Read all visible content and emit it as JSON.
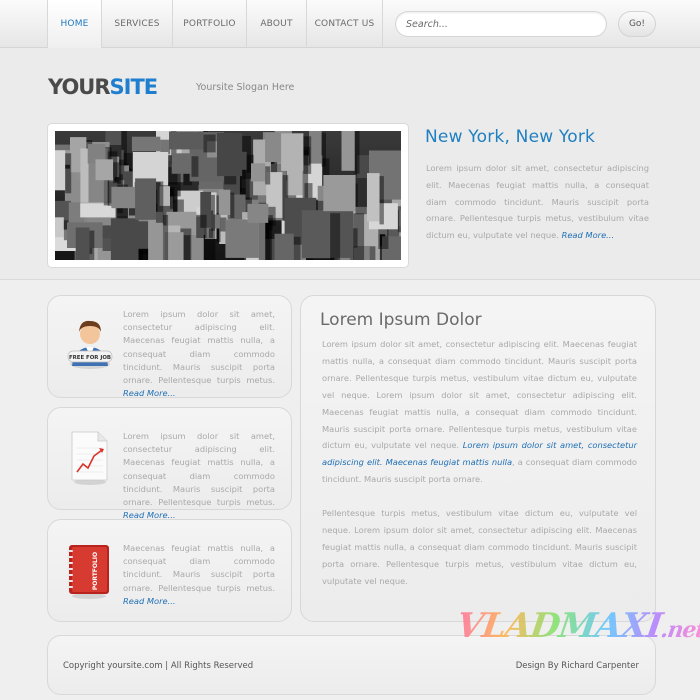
{
  "nav": {
    "items": [
      "HOME",
      "SERVICES",
      "PORTFOLIO",
      "ABOUT",
      "CONTACT US"
    ],
    "active_index": 0
  },
  "search": {
    "placeholder": "Search...",
    "go_label": "Go!"
  },
  "header": {
    "logo_part1": "YOUR",
    "logo_part2": "SITE",
    "slogan": "Yoursite Slogan Here"
  },
  "hero": {
    "title": "New York, New York",
    "text": "Lorem ipsum dolor sit amet, consectetur adipiscing elit. Maecenas feugiat mattis nulla, a consequat diam commodo tincidunt. Mauris suscipit porta ornare. Pellentesque turpis metus, vestibulum vitae dictum eu, vulputate vel neque.",
    "read_more": "Read More..."
  },
  "side_boxes": [
    {
      "icon": "free-for-job-person-icon",
      "icon_label": "FREE FOR JOB",
      "text": "Lorem ipsum dolor sit amet, consectetur adipiscing elit. Maecenas feugiat mattis nulla, a consequat diam commodo tincidunt. Mauris suscipit porta ornare. Pellentesque turpis metus.",
      "read_more": "Read More..."
    },
    {
      "icon": "chart-document-icon",
      "text": "Lorem ipsum dolor sit amet, consectetur adipiscing elit. Maecenas feugiat mattis nulla, a consequat diam commodo tincidunt. Mauris suscipit porta ornare. Pellentesque turpis metus.",
      "read_more": "Read More..."
    },
    {
      "icon": "portfolio-book-icon",
      "icon_label": "PORTFOLIO",
      "text": "Maecenas feugiat mattis nulla, a consequat diam commodo tincidunt. Mauris suscipit porta ornare. Pellentesque turpis metus.",
      "read_more": "Read More..."
    }
  ],
  "main": {
    "title": "Lorem Ipsum Dolor",
    "para1_a": "Lorem ipsum dolor sit amet, consectetur adipiscing elit. Maecenas feugiat mattis nulla, a consequat diam commodo tincidunt. Mauris suscipit porta ornare. Pellentesque turpis metus, vestibulum vitae dictum eu, vulputate vel neque. Lorem ipsum dolor sit amet, consectetur adipiscing elit. Maecenas feugiat mattis nulla, a consequat diam commodo tincidunt. Mauris suscipit porta ornare. Pellentesque turpis metus, vestibulum vitae dictum eu, vulputate vel neque. ",
    "para1_link": "Lorem ipsum dolor sit amet, consectetur adipiscing elit. Maecenas feugiat mattis nulla",
    "para1_b": ", a consequat diam commodo tincidunt. Mauris suscipit porta ornare.",
    "para2": "Pellentesque turpis metus, vestibulum vitae dictum eu, vulputate vel neque. Lorem ipsum dolor sit amet, consectetur adipiscing elit. Maecenas feugiat mattis nulla, a consequat diam commodo tincidunt. Mauris suscipit porta ornare. Pellentesque turpis metus, vestibulum vitae dictum eu, vulputate vel neque."
  },
  "footer": {
    "copyright": "Copyright yoursite.com | All Rights Reserved",
    "designer": "Design By Richard Carpenter"
  },
  "watermark": {
    "text": "VLADMAXI",
    "suffix": ".net"
  },
  "colors": {
    "accent": "#1f7fc1",
    "link": "#1f6fb5",
    "background": "#ebebeb"
  }
}
